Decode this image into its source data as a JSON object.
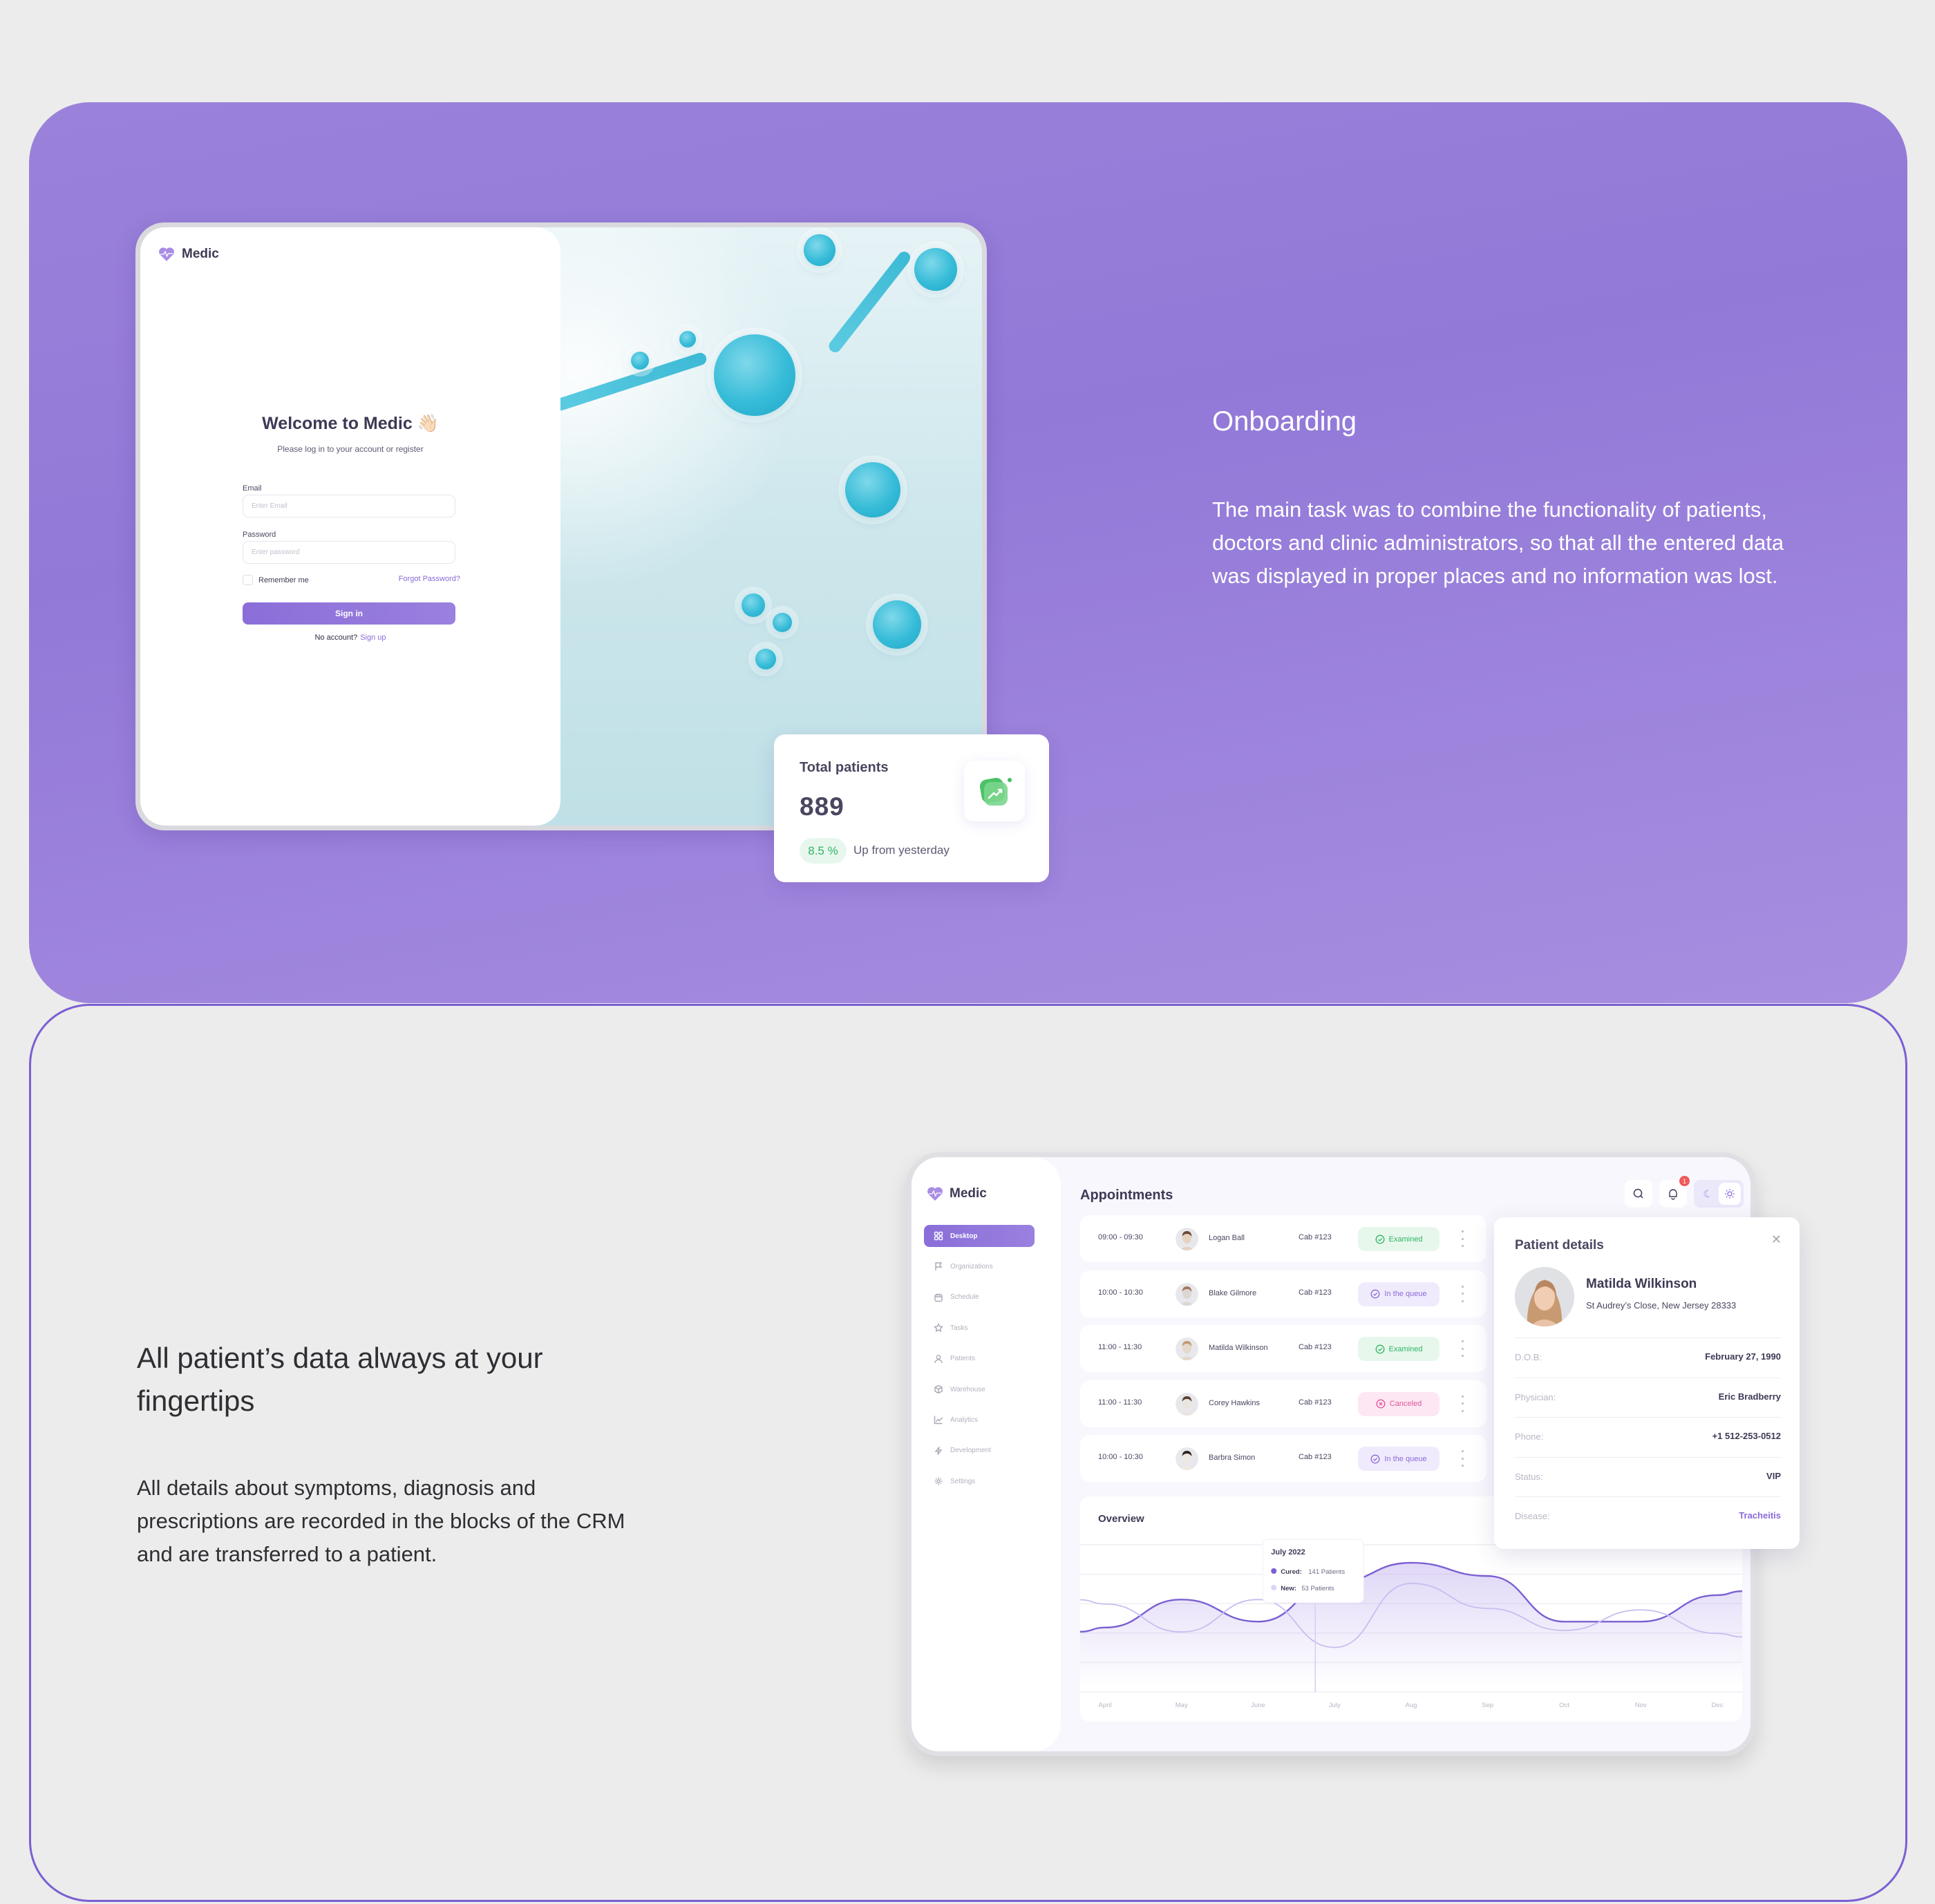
{
  "colors": {
    "accent": "#8a6ad8",
    "purple_panel": "#9a82da",
    "outline": "#7b5fd3",
    "examined": "#2fb463",
    "queue": "#8a6ad8",
    "canceled": "#e0559a",
    "notification": "#ef5a5a"
  },
  "onboarding": {
    "title": "Onboarding",
    "body": "The main task was to combine the functionality of patients, doctors and clinic administrators, so that all the entered data was displayed in proper places and no information was lost.",
    "login": {
      "brand": "Medic",
      "welcome": "Welcome to Medic 👋🏻",
      "subtitle": "Please log in to your account or register",
      "email_label": "Email",
      "email_placeholder": "Enter Email",
      "password_label": "Password",
      "password_placeholder": "Enter password",
      "remember_label": "Remember me",
      "forgot_label": "Forgot Password?",
      "signin_label": "Sign in",
      "no_account": "No account?",
      "signup_label": "Sign up"
    },
    "total_patients": {
      "title": "Total patients",
      "value": "889",
      "change": "8.5 %",
      "change_label": "Up from yesterday",
      "icon": "trend-up-icon"
    }
  },
  "crm": {
    "title": "All patient’s data always at your fingertips",
    "body": "All details about symptoms, diagnosis and prescriptions are recorded in the blocks of the CRM and are transferred to a patient.",
    "dashboard": {
      "brand": "Medic",
      "nav": [
        {
          "label": "Desktop",
          "icon": "grid-icon",
          "active": true
        },
        {
          "label": "Organizations",
          "icon": "flag-icon",
          "active": false
        },
        {
          "label": "Schedule",
          "icon": "calendar-icon",
          "active": false
        },
        {
          "label": "Tasks",
          "icon": "star-icon",
          "active": false
        },
        {
          "label": "Patients",
          "icon": "user-icon",
          "active": false
        },
        {
          "label": "Warehouse",
          "icon": "box-icon",
          "active": false
        },
        {
          "label": "Analytics",
          "icon": "chart-line-icon",
          "active": false
        },
        {
          "label": "Development",
          "icon": "bolt-icon",
          "active": false
        },
        {
          "label": "Settings",
          "icon": "gear-icon",
          "active": false
        }
      ],
      "appointments_title": "Appointments",
      "notifications_count": "1",
      "appointments": [
        {
          "time": "09:00 - 09:30",
          "name": "Logan Ball",
          "cab": "Cab #123",
          "status": "Examined",
          "kind": "examined"
        },
        {
          "time": "10:00 - 10:30",
          "name": "Blake Gilmore",
          "cab": "Cab #123",
          "status": "In the queue",
          "kind": "queue"
        },
        {
          "time": "11:00 - 11:30",
          "name": "Matilda Wilkinson",
          "cab": "Cab #123",
          "status": "Examined",
          "kind": "examined"
        },
        {
          "time": "11:00 - 11:30",
          "name": "Corey Hawkins",
          "cab": "Cab #123",
          "status": "Canceled",
          "kind": "canceled"
        },
        {
          "time": "10:00 - 10:30",
          "name": "Barbra Simon",
          "cab": "Cab #123",
          "status": "In the queue",
          "kind": "queue"
        }
      ],
      "overview_title": "Overview",
      "tooltip": {
        "title": "July 2022",
        "cured_label": "Cured:",
        "cured_value": "141 Patients",
        "new_label": "New:",
        "new_value": "53 Patients"
      },
      "patient_details": {
        "title": "Patient details",
        "name": "Matilda Wilkinson",
        "address": "St Audrey’s Close, New Jersey 28333",
        "fields": [
          {
            "label": "D.O.B:",
            "value": "February 27, 1990",
            "accent": false
          },
          {
            "label": "Physician:",
            "value": "Eric Bradberry",
            "accent": false
          },
          {
            "label": "Phone:",
            "value": "+1 512-253-0512",
            "accent": false
          },
          {
            "label": "Status:",
            "value": "VIP",
            "accent": false
          },
          {
            "label": "Disease:",
            "value": "Tracheitis",
            "accent": true
          }
        ]
      }
    }
  },
  "chart_data": {
    "type": "area",
    "title": "Overview",
    "categories": [
      "April",
      "May",
      "June",
      "July",
      "Aug",
      "Sep",
      "Oct",
      "Nov",
      "Dec"
    ],
    "series": [
      {
        "name": "Cured",
        "values": [
          80,
          118,
          88,
          141,
          168,
          150,
          88,
          88,
          124
        ],
        "color": "#7b5fd3",
        "filled": true
      },
      {
        "name": "New",
        "values": [
          112,
          74,
          118,
          53,
          140,
          106,
          76,
          104,
          72
        ],
        "color": "#c9bdf0",
        "filled": false
      }
    ],
    "highlight": {
      "category": "July",
      "label": "July 2022",
      "cured": 141,
      "new": 53
    },
    "ylim": [
      0,
      200
    ],
    "grid": true,
    "legend": "tooltip"
  }
}
